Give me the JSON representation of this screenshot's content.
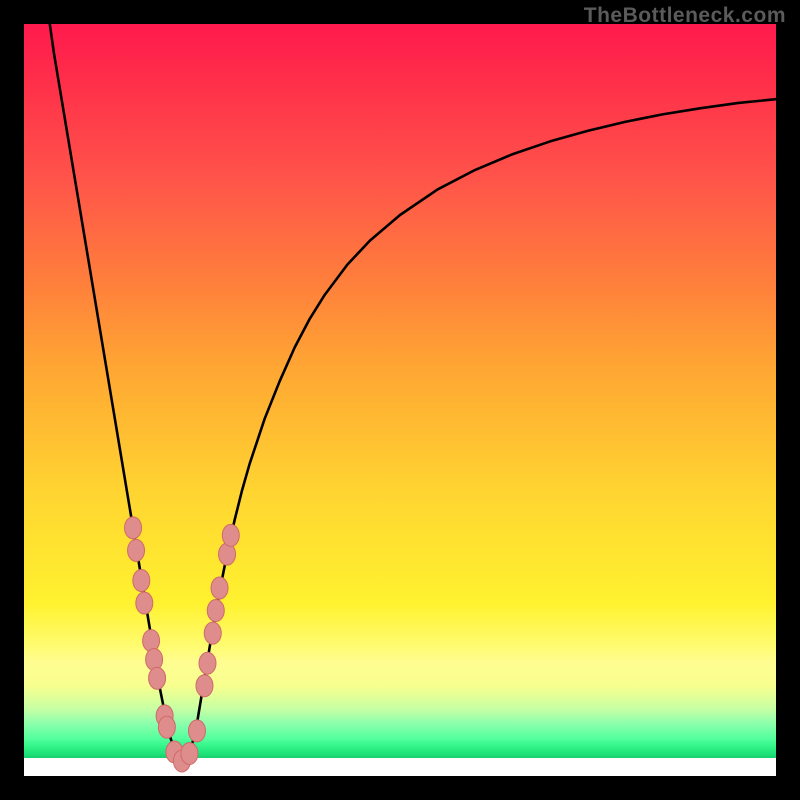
{
  "watermark": {
    "text": "TheBottleneck.com"
  },
  "colors": {
    "curve": "#000000",
    "bead_fill": "#df8c8c",
    "bead_stroke": "#cf6a6a"
  },
  "chart_data": {
    "type": "line",
    "title": "",
    "xlabel": "",
    "ylabel": "",
    "xlim": [
      0,
      100
    ],
    "ylim": [
      0,
      100
    ],
    "grid": false,
    "legend": false,
    "series": [
      {
        "name": "bottleneck-curve",
        "x": [
          3,
          4,
          5,
          6,
          7,
          8,
          9,
          10,
          11,
          12,
          13,
          14,
          15,
          16,
          17,
          18,
          18.8,
          19.5,
          20,
          20.5,
          21,
          21.5,
          22,
          22.5,
          23,
          23.5,
          24,
          25,
          26,
          27,
          28,
          29,
          30,
          32,
          34,
          36,
          38,
          40,
          43,
          46,
          50,
          55,
          60,
          65,
          70,
          75,
          80,
          85,
          90,
          95,
          100
        ],
        "values": [
          103,
          96,
          90,
          84,
          78,
          72,
          66,
          60,
          54,
          48,
          42,
          36,
          30,
          24,
          18,
          12,
          8,
          5,
          3.5,
          2.5,
          2,
          2.3,
          3,
          4.8,
          7,
          10,
          13,
          19,
          24.5,
          29.5,
          34,
          38,
          41.5,
          47.5,
          52.5,
          57,
          60.8,
          64,
          68,
          71.2,
          74.6,
          78,
          80.6,
          82.7,
          84.4,
          85.8,
          87,
          88,
          88.8,
          89.5,
          90
        ]
      }
    ],
    "markers": [
      {
        "name": "bead-left-1",
        "x": 14.5,
        "y": 33
      },
      {
        "name": "bead-left-2",
        "x": 14.9,
        "y": 30
      },
      {
        "name": "bead-left-3",
        "x": 15.6,
        "y": 26
      },
      {
        "name": "bead-left-4",
        "x": 16.0,
        "y": 23
      },
      {
        "name": "bead-left-5",
        "x": 16.9,
        "y": 18
      },
      {
        "name": "bead-left-6",
        "x": 17.3,
        "y": 15.5
      },
      {
        "name": "bead-left-7",
        "x": 17.7,
        "y": 13
      },
      {
        "name": "bead-left-8",
        "x": 18.7,
        "y": 8
      },
      {
        "name": "bead-left-9",
        "x": 19.0,
        "y": 6.5
      },
      {
        "name": "bead-bot-1",
        "x": 20.0,
        "y": 3.2
      },
      {
        "name": "bead-bot-2",
        "x": 21.0,
        "y": 2.0
      },
      {
        "name": "bead-bot-3",
        "x": 22.0,
        "y": 3.0
      },
      {
        "name": "bead-bot-4",
        "x": 23.0,
        "y": 6.0
      },
      {
        "name": "bead-right-1",
        "x": 24.0,
        "y": 12
      },
      {
        "name": "bead-right-2",
        "x": 24.4,
        "y": 15
      },
      {
        "name": "bead-right-3",
        "x": 25.1,
        "y": 19
      },
      {
        "name": "bead-right-4",
        "x": 25.5,
        "y": 22
      },
      {
        "name": "bead-right-5",
        "x": 26.0,
        "y": 25
      },
      {
        "name": "bead-right-6",
        "x": 27.0,
        "y": 29.5
      },
      {
        "name": "bead-right-7",
        "x": 27.5,
        "y": 32
      }
    ]
  }
}
